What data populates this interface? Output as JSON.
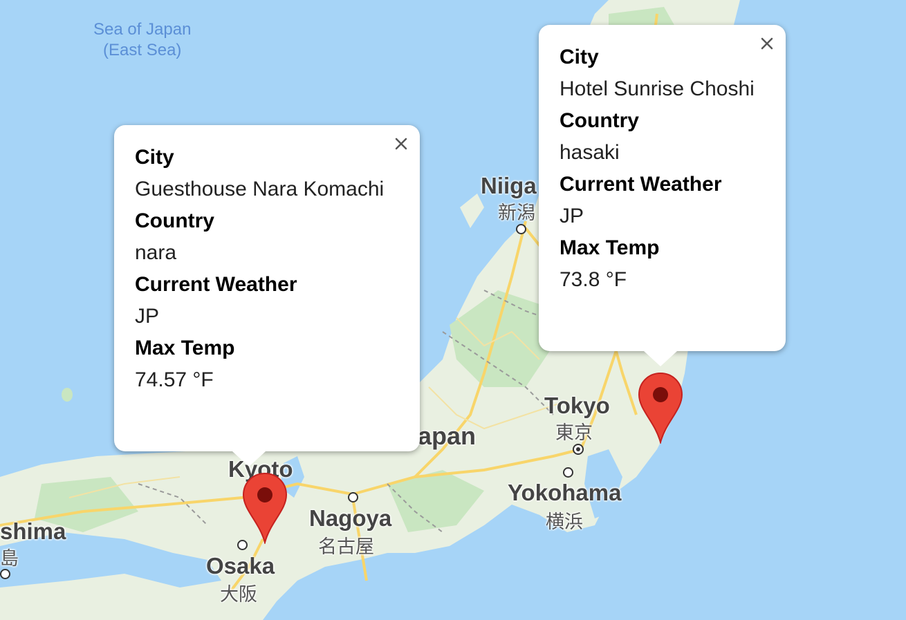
{
  "map": {
    "sea_label_line1": "Sea of Japan",
    "sea_label_line2": "(East Sea)",
    "labels": {
      "niigata": "Niiga",
      "niigata_kanji": "新潟",
      "tokyo": "Tokyo",
      "tokyo_kanji": "東京",
      "yokohama": "Yokohama",
      "yokohama_kanji": "横浜",
      "japan": "apan",
      "kyoto": "Kyoto",
      "nagoya": "Nagoya",
      "nagoya_kanji": "名古屋",
      "osaka": "Osaka",
      "osaka_kanji": "大阪",
      "hiroshima": "shima",
      "hiroshima_kanji": "島"
    },
    "colors": {
      "water": "#a6d4f7",
      "land": "#e9f0e1",
      "forest": "#c9e6c1",
      "road": "#f8d56a",
      "marker": "#ea4335",
      "marker_dot": "#7a0e0a"
    }
  },
  "info_windows": {
    "nara": {
      "city_label": "City",
      "city_value": "Guesthouse Nara Komachi",
      "country_label": "Country",
      "country_value": "nara",
      "weather_label": "Current Weather",
      "weather_value": "JP",
      "temp_label": "Max Temp",
      "temp_value": "74.57 °F"
    },
    "hasaki": {
      "city_label": "City",
      "city_value": "Hotel Sunrise Choshi",
      "country_label": "Country",
      "country_value": "hasaki",
      "weather_label": "Current Weather",
      "weather_value": "JP",
      "temp_label": "Max Temp",
      "temp_value": "73.8 °F"
    }
  }
}
